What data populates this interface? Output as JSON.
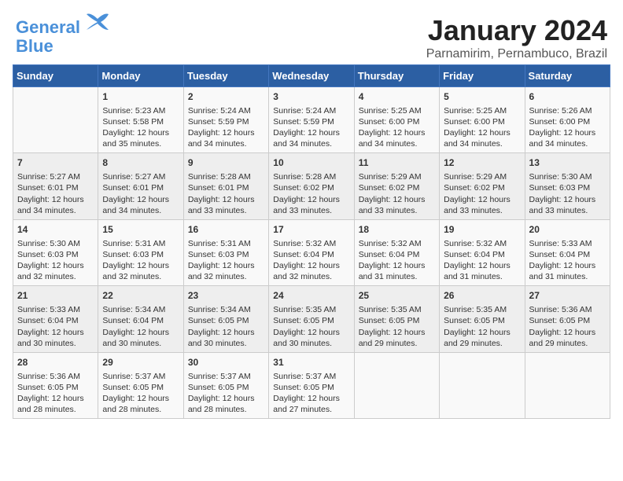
{
  "logo": {
    "line1": "General",
    "line2": "Blue"
  },
  "title": "January 2024",
  "location": "Parnamirim, Pernambuco, Brazil",
  "headers": [
    "Sunday",
    "Monday",
    "Tuesday",
    "Wednesday",
    "Thursday",
    "Friday",
    "Saturday"
  ],
  "weeks": [
    [
      {
        "day": "",
        "content": ""
      },
      {
        "day": "1",
        "content": "Sunrise: 5:23 AM\nSunset: 5:58 PM\nDaylight: 12 hours\nand 35 minutes."
      },
      {
        "day": "2",
        "content": "Sunrise: 5:24 AM\nSunset: 5:59 PM\nDaylight: 12 hours\nand 34 minutes."
      },
      {
        "day": "3",
        "content": "Sunrise: 5:24 AM\nSunset: 5:59 PM\nDaylight: 12 hours\nand 34 minutes."
      },
      {
        "day": "4",
        "content": "Sunrise: 5:25 AM\nSunset: 6:00 PM\nDaylight: 12 hours\nand 34 minutes."
      },
      {
        "day": "5",
        "content": "Sunrise: 5:25 AM\nSunset: 6:00 PM\nDaylight: 12 hours\nand 34 minutes."
      },
      {
        "day": "6",
        "content": "Sunrise: 5:26 AM\nSunset: 6:00 PM\nDaylight: 12 hours\nand 34 minutes."
      }
    ],
    [
      {
        "day": "7",
        "content": "Sunrise: 5:27 AM\nSunset: 6:01 PM\nDaylight: 12 hours\nand 34 minutes."
      },
      {
        "day": "8",
        "content": "Sunrise: 5:27 AM\nSunset: 6:01 PM\nDaylight: 12 hours\nand 34 minutes."
      },
      {
        "day": "9",
        "content": "Sunrise: 5:28 AM\nSunset: 6:01 PM\nDaylight: 12 hours\nand 33 minutes."
      },
      {
        "day": "10",
        "content": "Sunrise: 5:28 AM\nSunset: 6:02 PM\nDaylight: 12 hours\nand 33 minutes."
      },
      {
        "day": "11",
        "content": "Sunrise: 5:29 AM\nSunset: 6:02 PM\nDaylight: 12 hours\nand 33 minutes."
      },
      {
        "day": "12",
        "content": "Sunrise: 5:29 AM\nSunset: 6:02 PM\nDaylight: 12 hours\nand 33 minutes."
      },
      {
        "day": "13",
        "content": "Sunrise: 5:30 AM\nSunset: 6:03 PM\nDaylight: 12 hours\nand 33 minutes."
      }
    ],
    [
      {
        "day": "14",
        "content": "Sunrise: 5:30 AM\nSunset: 6:03 PM\nDaylight: 12 hours\nand 32 minutes."
      },
      {
        "day": "15",
        "content": "Sunrise: 5:31 AM\nSunset: 6:03 PM\nDaylight: 12 hours\nand 32 minutes."
      },
      {
        "day": "16",
        "content": "Sunrise: 5:31 AM\nSunset: 6:03 PM\nDaylight: 12 hours\nand 32 minutes."
      },
      {
        "day": "17",
        "content": "Sunrise: 5:32 AM\nSunset: 6:04 PM\nDaylight: 12 hours\nand 32 minutes."
      },
      {
        "day": "18",
        "content": "Sunrise: 5:32 AM\nSunset: 6:04 PM\nDaylight: 12 hours\nand 31 minutes."
      },
      {
        "day": "19",
        "content": "Sunrise: 5:32 AM\nSunset: 6:04 PM\nDaylight: 12 hours\nand 31 minutes."
      },
      {
        "day": "20",
        "content": "Sunrise: 5:33 AM\nSunset: 6:04 PM\nDaylight: 12 hours\nand 31 minutes."
      }
    ],
    [
      {
        "day": "21",
        "content": "Sunrise: 5:33 AM\nSunset: 6:04 PM\nDaylight: 12 hours\nand 30 minutes."
      },
      {
        "day": "22",
        "content": "Sunrise: 5:34 AM\nSunset: 6:04 PM\nDaylight: 12 hours\nand 30 minutes."
      },
      {
        "day": "23",
        "content": "Sunrise: 5:34 AM\nSunset: 6:05 PM\nDaylight: 12 hours\nand 30 minutes."
      },
      {
        "day": "24",
        "content": "Sunrise: 5:35 AM\nSunset: 6:05 PM\nDaylight: 12 hours\nand 30 minutes."
      },
      {
        "day": "25",
        "content": "Sunrise: 5:35 AM\nSunset: 6:05 PM\nDaylight: 12 hours\nand 29 minutes."
      },
      {
        "day": "26",
        "content": "Sunrise: 5:35 AM\nSunset: 6:05 PM\nDaylight: 12 hours\nand 29 minutes."
      },
      {
        "day": "27",
        "content": "Sunrise: 5:36 AM\nSunset: 6:05 PM\nDaylight: 12 hours\nand 29 minutes."
      }
    ],
    [
      {
        "day": "28",
        "content": "Sunrise: 5:36 AM\nSunset: 6:05 PM\nDaylight: 12 hours\nand 28 minutes."
      },
      {
        "day": "29",
        "content": "Sunrise: 5:37 AM\nSunset: 6:05 PM\nDaylight: 12 hours\nand 28 minutes."
      },
      {
        "day": "30",
        "content": "Sunrise: 5:37 AM\nSunset: 6:05 PM\nDaylight: 12 hours\nand 28 minutes."
      },
      {
        "day": "31",
        "content": "Sunrise: 5:37 AM\nSunset: 6:05 PM\nDaylight: 12 hours\nand 27 minutes."
      },
      {
        "day": "",
        "content": ""
      },
      {
        "day": "",
        "content": ""
      },
      {
        "day": "",
        "content": ""
      }
    ]
  ]
}
